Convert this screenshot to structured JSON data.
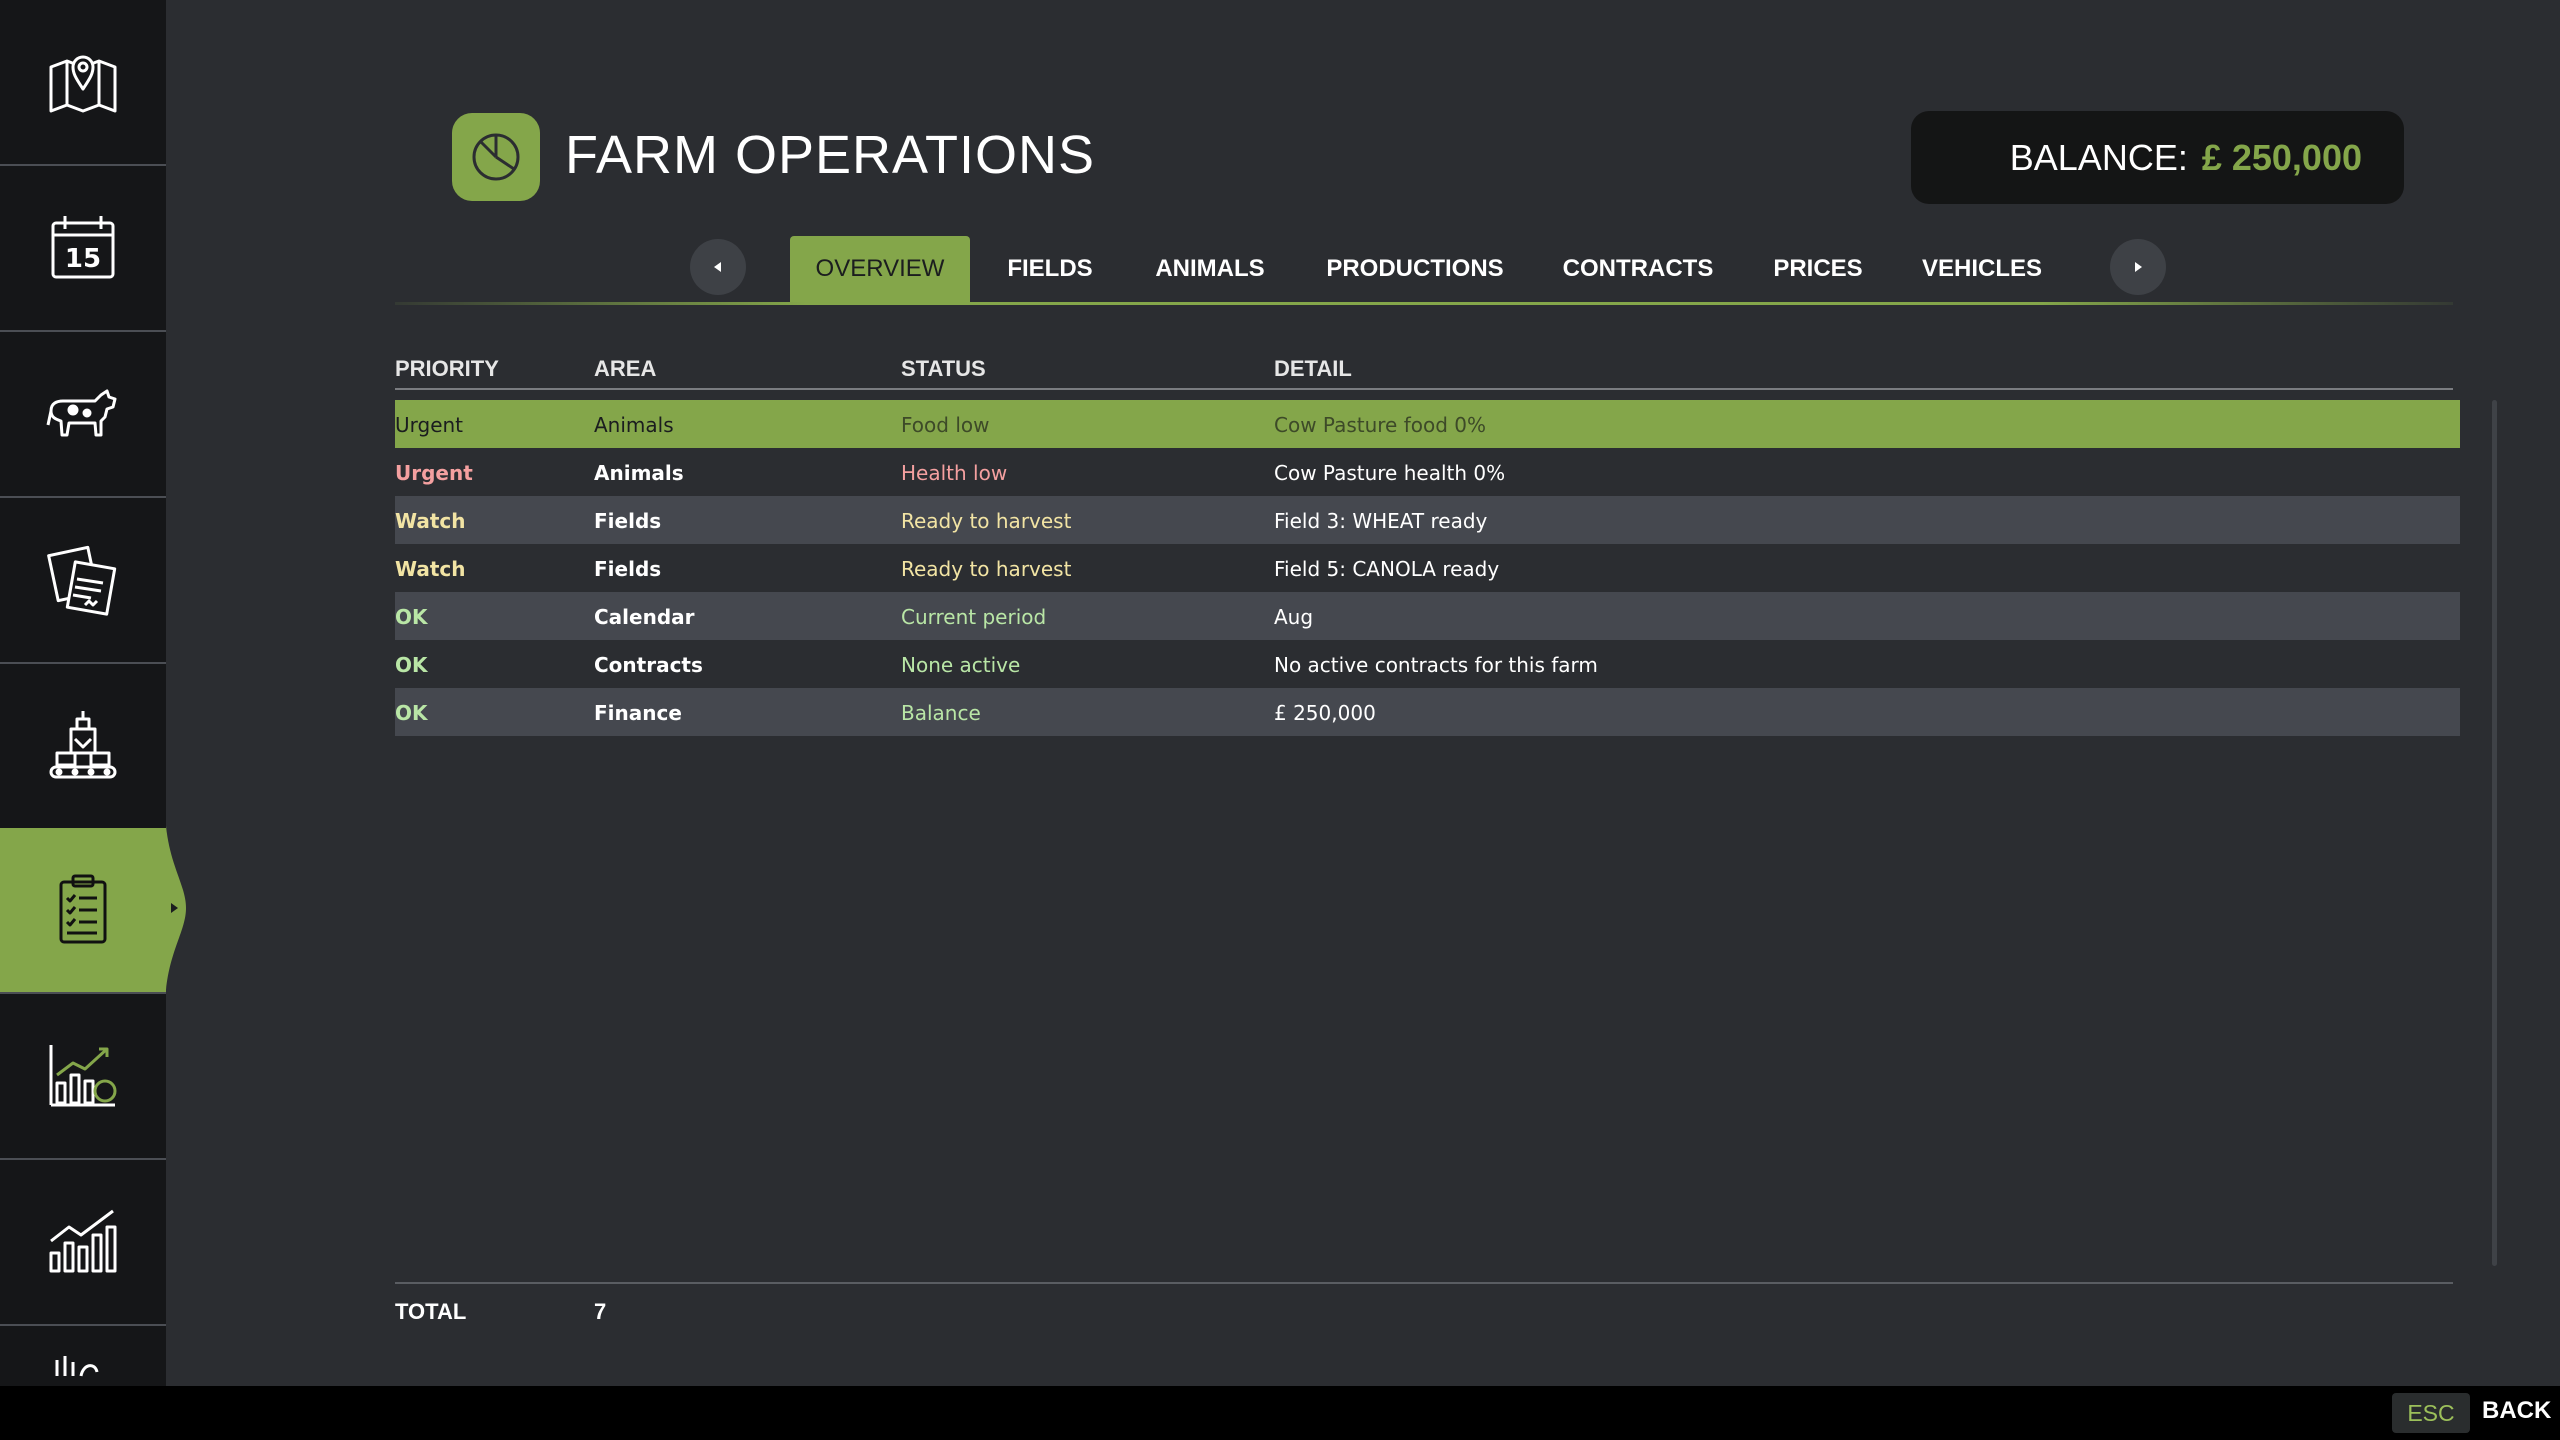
{
  "sidebar": {
    "items": [
      {
        "icon": "map-icon",
        "active": false
      },
      {
        "icon": "calendar-icon",
        "active": false,
        "day": "15"
      },
      {
        "icon": "cow-icon",
        "active": false
      },
      {
        "icon": "contracts-icon",
        "active": false
      },
      {
        "icon": "production-icon",
        "active": false
      },
      {
        "icon": "clipboard-checklist-icon",
        "active": true
      },
      {
        "icon": "finance-chart-icon",
        "active": false
      },
      {
        "icon": "statistics-chart-icon",
        "active": false
      },
      {
        "icon": "partial-icon",
        "active": false
      }
    ]
  },
  "header": {
    "icon": "pie-chart-icon",
    "title": "FARM OPERATIONS",
    "balance_label": "BALANCE:",
    "balance_value": "£ 250,000"
  },
  "tabs": {
    "prev_icon": "chevron-left-icon",
    "next_icon": "chevron-right-icon",
    "items": [
      {
        "label": "OVERVIEW",
        "active": true
      },
      {
        "label": "FIELDS",
        "active": false
      },
      {
        "label": "ANIMALS",
        "active": false
      },
      {
        "label": "PRODUCTIONS",
        "active": false
      },
      {
        "label": "CONTRACTS",
        "active": false
      },
      {
        "label": "PRICES",
        "active": false
      },
      {
        "label": "VEHICLES",
        "active": false
      }
    ]
  },
  "table": {
    "columns": [
      "PRIORITY",
      "AREA",
      "STATUS",
      "DETAIL"
    ],
    "rows": [
      {
        "priority": "Urgent",
        "area": "Animals",
        "status": "Food low",
        "detail": "Cow Pasture food 0%",
        "selected": true
      },
      {
        "priority": "Urgent",
        "area": "Animals",
        "status": "Health low",
        "detail": "Cow Pasture health 0%",
        "selected": false
      },
      {
        "priority": "Watch",
        "area": "Fields",
        "status": "Ready to harvest",
        "detail": "Field 3: WHEAT ready",
        "selected": false
      },
      {
        "priority": "Watch",
        "area": "Fields",
        "status": "Ready to harvest",
        "detail": "Field 5: CANOLA ready",
        "selected": false
      },
      {
        "priority": "OK",
        "area": "Calendar",
        "status": "Current period",
        "detail": "Aug",
        "selected": false
      },
      {
        "priority": "OK",
        "area": "Contracts",
        "status": "None active",
        "detail": "No active contracts for this farm",
        "selected": false
      },
      {
        "priority": "OK",
        "area": "Finance",
        "status": "Balance",
        "detail": "£ 250,000",
        "selected": false
      }
    ]
  },
  "footer": {
    "total_label": "TOTAL",
    "total_value": "7"
  },
  "bottom_bar": {
    "esc_key": "ESC",
    "back_label": "BACK"
  },
  "colors": {
    "accent": "#84a64a",
    "urgent": "#f4a0a0",
    "watch": "#f2e4a4",
    "ok": "#b9e6a6",
    "background": "#2b2d31",
    "sidebar": "#151618"
  }
}
